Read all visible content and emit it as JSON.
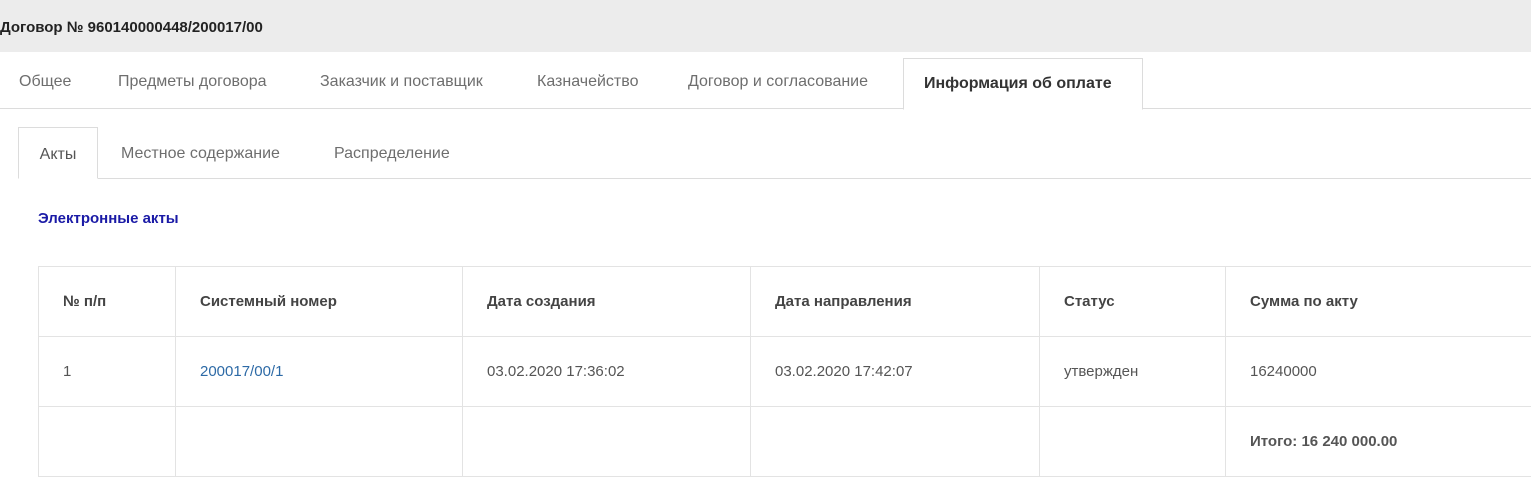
{
  "header": {
    "title": "Договор № 960140000448/200017/00"
  },
  "main_tabs": [
    {
      "label": "Общее"
    },
    {
      "label": "Предметы договора"
    },
    {
      "label": "Заказчик и поставщик"
    },
    {
      "label": "Казначейство"
    },
    {
      "label": "Договор и согласование"
    },
    {
      "label": "Информация об оплате",
      "active": true
    }
  ],
  "sub_tabs": [
    {
      "label": "Акты",
      "active": true
    },
    {
      "label": "Местное содержание"
    },
    {
      "label": "Распределение"
    }
  ],
  "section": {
    "title": "Электронные акты"
  },
  "table": {
    "columns": [
      "№ п/п",
      "Системный номер",
      "Дата создания",
      "Дата направления",
      "Статус",
      "Сумма по акту"
    ],
    "rows": [
      {
        "num": "1",
        "system_number": "200017/00/1",
        "created": "03.02.2020 17:36:02",
        "sent": "03.02.2020 17:42:07",
        "status": "утвержден",
        "amount": "16240000"
      }
    ],
    "total_label": "Итого: 16 240 000.00"
  },
  "colors": {
    "link": "#2d6aa6",
    "section_title": "#1a1aa6",
    "header_bg": "#ececec"
  }
}
